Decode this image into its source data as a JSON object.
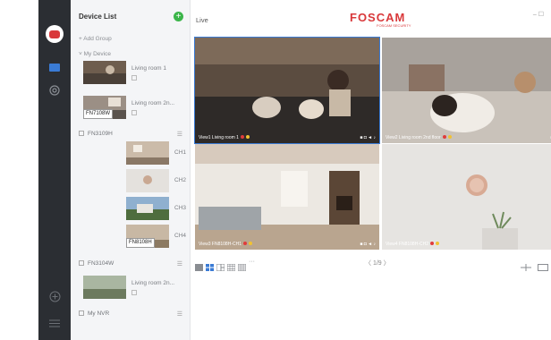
{
  "sidebar_list": {
    "title": "Device List",
    "add_group": "+ Add Group",
    "my_device": "˅ My Device",
    "devices": [
      {
        "name": "Living room 1"
      },
      {
        "name": "Living room 2n...",
        "model": "FN7108W"
      }
    ],
    "nvr1": {
      "name": "FN3109H"
    },
    "channels": [
      "CH1",
      "CH2",
      "CH3",
      "CH4"
    ],
    "channel_badge": "FN8108H",
    "nvr2": {
      "name": "FN3104W"
    },
    "nvr2_device": {
      "name": "Living room 2n..."
    },
    "nvr3": {
      "name": "My NVR"
    }
  },
  "main": {
    "live_label": "Live",
    "brand": "FOSCAM",
    "brand_sub": "FOSCAM SECURITY",
    "window_controls": "–  ☐",
    "tiles": [
      {
        "caption": "View1 Living room 1"
      },
      {
        "caption": "View2 Living room 2nd floor"
      },
      {
        "caption": "View3 FN8108H-CH1"
      },
      {
        "caption": "View4 FN8108H-CH2"
      }
    ],
    "pager": "〈  1/9  〉",
    "more_layouts": "···"
  },
  "colors": {
    "brand": "#d9383a",
    "rail": "#2b2e33",
    "accent": "#3a7bd5",
    "add_green": "#3bb54a"
  },
  "icons": [
    "foscam-logo-icon",
    "camera-icon",
    "settings-icon",
    "add-circle-icon",
    "menu-icon",
    "snapshot-icon",
    "record-icon",
    "volume-icon",
    "mic-icon",
    "ptz-icon",
    "fullscreen-icon"
  ]
}
